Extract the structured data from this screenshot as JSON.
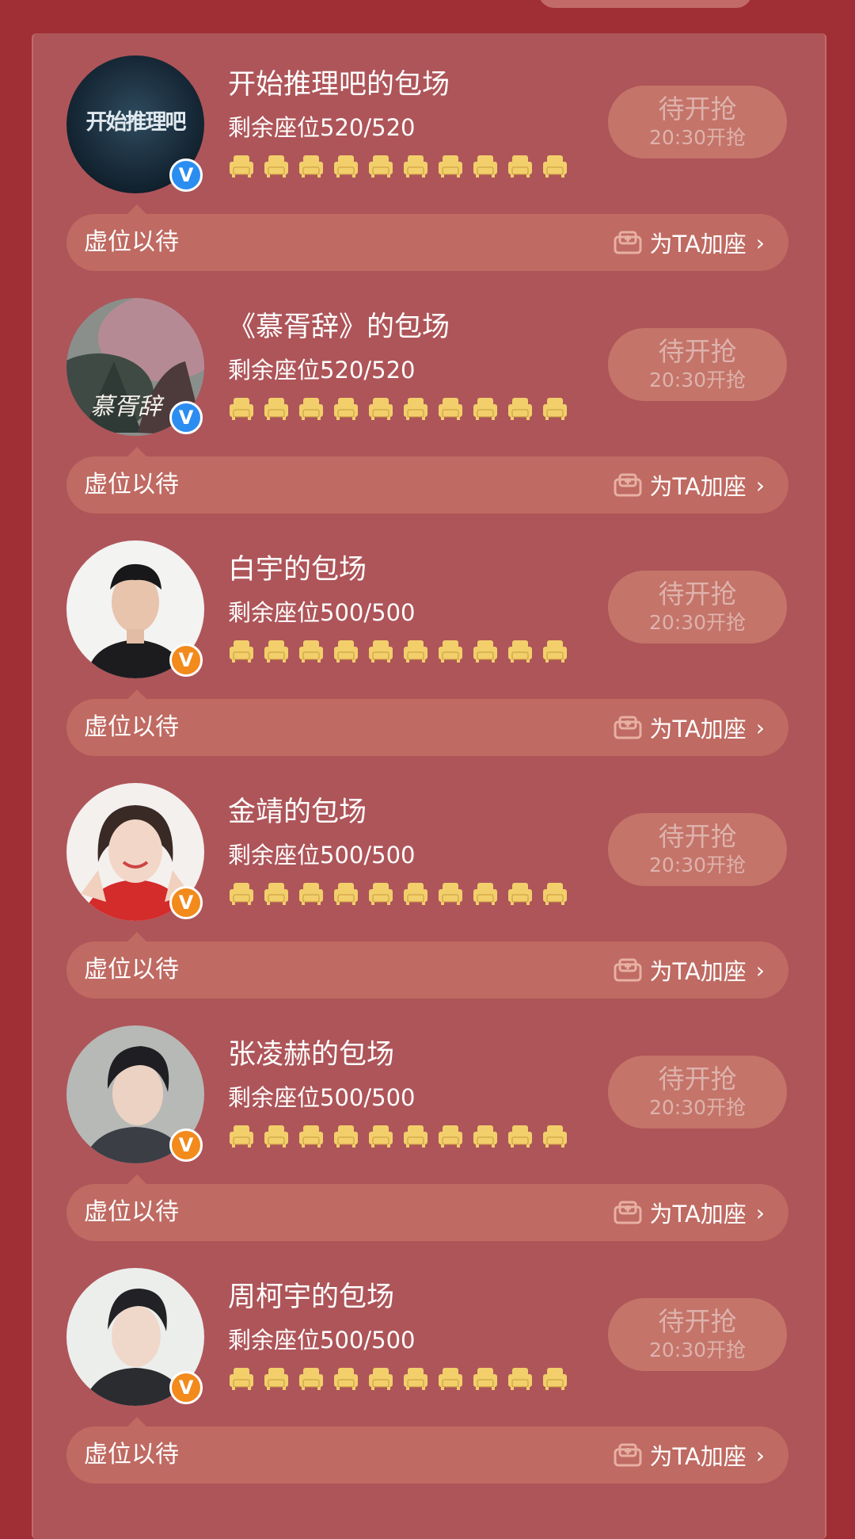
{
  "cards": [
    {
      "title": "开始推理吧的包场",
      "seats_label": "剩余座位",
      "seats_count": "520/520",
      "seat_icon_count": 10,
      "verified_badge": "blue-v-icon",
      "avatar_logo": "开始推理吧",
      "button_main": "待开抢",
      "button_sub": "20:30开抢",
      "vacancy_text": "虚位以待",
      "add_seat_text": "为TA加座",
      "chevron": "›"
    },
    {
      "title": "《慕胥辞》的包场",
      "seats_label": "剩余座位",
      "seats_count": "520/520",
      "seat_icon_count": 10,
      "verified_badge": "blue-v-icon",
      "avatar_logo": "慕胥辞",
      "button_main": "待开抢",
      "button_sub": "20:30开抢",
      "vacancy_text": "虚位以待",
      "add_seat_text": "为TA加座",
      "chevron": "›"
    },
    {
      "title": "白宇的包场",
      "seats_label": "剩余座位",
      "seats_count": "500/500",
      "seat_icon_count": 10,
      "verified_badge": "orange-v-icon",
      "button_main": "待开抢",
      "button_sub": "20:30开抢",
      "vacancy_text": "虚位以待",
      "add_seat_text": "为TA加座",
      "chevron": "›"
    },
    {
      "title": "金靖的包场",
      "seats_label": "剩余座位",
      "seats_count": "500/500",
      "seat_icon_count": 10,
      "verified_badge": "orange-v-icon",
      "button_main": "待开抢",
      "button_sub": "20:30开抢",
      "vacancy_text": "虚位以待",
      "add_seat_text": "为TA加座",
      "chevron": "›"
    },
    {
      "title": "张凌赫的包场",
      "seats_label": "剩余座位",
      "seats_count": "500/500",
      "seat_icon_count": 10,
      "verified_badge": "orange-v-icon",
      "button_main": "待开抢",
      "button_sub": "20:30开抢",
      "vacancy_text": "虚位以待",
      "add_seat_text": "为TA加座",
      "chevron": "›"
    },
    {
      "title": "周柯宇的包场",
      "seats_label": "剩余座位",
      "seats_count": "500/500",
      "seat_icon_count": 10,
      "verified_badge": "orange-v-icon",
      "button_main": "待开抢",
      "button_sub": "20:30开抢",
      "vacancy_text": "虚位以待",
      "add_seat_text": "为TA加座",
      "chevron": "›"
    }
  ],
  "colors": {
    "page_background": "#9f2f35",
    "panel": "#ae5559",
    "bar": "#bf6a62",
    "button": "#c47469",
    "seat_icon": "#f2cf6b",
    "badge_blue": "#2c8df0",
    "badge_orange": "#f28a1c"
  },
  "badge_letter": "V"
}
